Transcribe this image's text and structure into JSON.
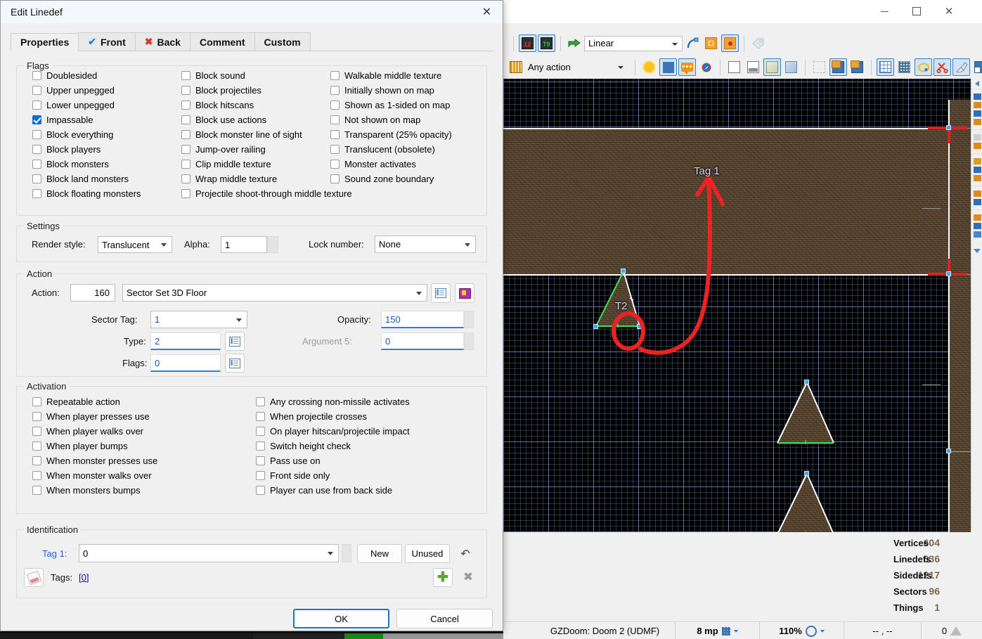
{
  "dialog": {
    "title": "Edit Linedef",
    "close_icon": "close-icon",
    "tabs": [
      {
        "label": "Properties",
        "icon": "",
        "active": true
      },
      {
        "label": "Front",
        "icon": "check-blue-icon",
        "active": false
      },
      {
        "label": "Back",
        "icon": "x-red-icon",
        "active": false
      },
      {
        "label": "Comment",
        "icon": "",
        "active": false
      },
      {
        "label": "Custom",
        "icon": "",
        "active": false
      }
    ],
    "flags": {
      "title": "Flags",
      "col1": [
        {
          "label": "Doublesided",
          "checked": false
        },
        {
          "label": "Upper unpegged",
          "checked": false
        },
        {
          "label": "Lower unpegged",
          "checked": false
        },
        {
          "label": "Impassable",
          "checked": true
        },
        {
          "label": "Block everything",
          "checked": false
        },
        {
          "label": "Block players",
          "checked": false
        },
        {
          "label": "Block monsters",
          "checked": false
        },
        {
          "label": "Block land monsters",
          "checked": false
        },
        {
          "label": "Block floating monsters",
          "checked": false
        }
      ],
      "col2": [
        {
          "label": "Block sound",
          "checked": false
        },
        {
          "label": "Block projectiles",
          "checked": false
        },
        {
          "label": "Block hitscans",
          "checked": false
        },
        {
          "label": "Block use actions",
          "checked": false
        },
        {
          "label": "Block monster line of sight",
          "checked": false
        },
        {
          "label": "Jump-over railing",
          "checked": false
        },
        {
          "label": "Clip middle texture",
          "checked": false
        },
        {
          "label": "Wrap middle texture",
          "checked": false
        },
        {
          "label": "Projectile shoot-through middle texture",
          "checked": false
        }
      ],
      "col3": [
        {
          "label": "Walkable middle texture",
          "checked": false
        },
        {
          "label": "Initially shown on map",
          "checked": false
        },
        {
          "label": "Shown as 1-sided on map",
          "checked": false
        },
        {
          "label": "Not shown on map",
          "checked": false
        },
        {
          "label": "Transparent (25% opacity)",
          "checked": false
        },
        {
          "label": "Translucent (obsolete)",
          "checked": false
        },
        {
          "label": "Monster activates",
          "checked": false
        },
        {
          "label": "Sound zone boundary",
          "checked": false
        }
      ]
    },
    "settings": {
      "title": "Settings",
      "render_style_label": "Render style:",
      "render_style_value": "Translucent",
      "alpha_label": "Alpha:",
      "alpha_value": "1",
      "lock_number_label": "Lock number:",
      "lock_number_value": "None"
    },
    "action": {
      "title": "Action",
      "action_label": "Action:",
      "action_number": "160",
      "action_name": "Sector Set 3D Floor",
      "browse_icon": "list-icon",
      "help_icon": "book-icon",
      "sector_tag_label": "Sector Tag:",
      "sector_tag_value": "1",
      "type_label": "Type:",
      "type_value": "2",
      "flags_label": "Flags:",
      "flags_value": "0",
      "opacity_label": "Opacity:",
      "opacity_value": "150",
      "argument5_label": "Argument 5:",
      "argument5_value": "0",
      "argument5_disabled": true
    },
    "activation": {
      "title": "Activation",
      "col1": [
        {
          "label": "Repeatable action",
          "checked": false
        },
        {
          "label": "When player presses use",
          "checked": false
        },
        {
          "label": "When player walks over",
          "checked": false
        },
        {
          "label": "When player bumps",
          "checked": false
        },
        {
          "label": "When monster presses use",
          "checked": false
        },
        {
          "label": "When monster walks over",
          "checked": false
        },
        {
          "label": "When monsters bumps",
          "checked": false
        }
      ],
      "col2": [
        {
          "label": "Any crossing non-missile activates",
          "checked": false
        },
        {
          "label": "When projectile crosses",
          "checked": false
        },
        {
          "label": "On player hitscan/projectile impact",
          "checked": false
        },
        {
          "label": "Switch height check",
          "checked": false
        },
        {
          "label": "Pass use on",
          "checked": false
        },
        {
          "label": "Front side only",
          "checked": false
        },
        {
          "label": "Player can use from back side",
          "checked": false
        }
      ]
    },
    "identification": {
      "title": "Identification",
      "tag1_label": "Tag 1:",
      "tag1_value": "0",
      "new_label": "New",
      "unused_label": "Unused",
      "undo_icon": "undo-icon",
      "eraser_icon": "eraser-icon",
      "tags_label": "Tags:",
      "tags_value": "[0]",
      "add_icon": "plus-icon",
      "remove_icon": "delete-icon"
    },
    "footer": {
      "ok_label": "OK",
      "cancel_label": "Cancel"
    }
  },
  "editor": {
    "window_controls": {
      "minimize": "minimize-icon",
      "maximize": "maximize-icon",
      "close": "close-icon"
    },
    "toolbar_row1": {
      "btn_12": {
        "name": "texture-12-toggle",
        "label": "12",
        "checked": true
      },
      "btn_t9": {
        "name": "texture-t9-toggle",
        "label": "T9",
        "checked": true
      },
      "export_icon": "export-icon",
      "curve_mode_value": "Linear",
      "curve_icon": "curve-icon",
      "grid_move_icon": "grid-move-icon",
      "pivot_icon": "pivot-icon",
      "tag_icon": "tag-icon"
    },
    "toolbar_row2": {
      "action_filter_icon": "columns-icon",
      "action_filter_value": "Any action",
      "brightness_icon": "brightness-icon",
      "grid_icon": "grid-icon",
      "comments_icon": "comments-icon",
      "compass_icon": "compass-icon",
      "full_bright_icon": "full-bright-icon",
      "floor_icon": "floor-icon",
      "ceiling_icon": "ceiling-icon",
      "lower_icon": "lower-icon",
      "select_icon": "marquee-select-icon",
      "sector_add_icon": "sector-add-icon",
      "sector_copy_icon": "sector-copy-icon",
      "snap_grid_icon": "snap-grid-icon",
      "grid_dense_icon": "grid-dense-icon",
      "color_picker_icon": "color-picker-icon",
      "cut_icon": "scissors-icon",
      "brush_icon": "brush-icon",
      "lock_floor_icon": "lock-floor-icon",
      "lock_ceiling_icon": "lock-ceiling-icon"
    },
    "map": {
      "annotations": [
        {
          "text": "Tag 1",
          "name": "map-annotation-tag1"
        },
        {
          "text": "T2",
          "name": "map-annotation-t2"
        }
      ]
    },
    "stats": [
      {
        "value": "604",
        "label": "Vertices"
      },
      {
        "value": "636",
        "label": "Linedefs"
      },
      {
        "value": "1217",
        "label": "Sidedefs"
      },
      {
        "value": "96",
        "label": "Sectors"
      },
      {
        "value": "1",
        "label": "Things"
      }
    ],
    "statusbar": {
      "game_config": "GZDoom: Doom 2 (UDMF)",
      "grid_size": "8 mp",
      "zoom": "110%",
      "coordinates": "-- , --",
      "counter": "0",
      "grid_icon": "grid-icon",
      "zoom_icon": "magnifier-icon",
      "triangle_icon": "triangle-icon"
    }
  },
  "colors": {
    "accent": "#1877c9",
    "annotation_red": "#ee2222",
    "map_background": "#000000",
    "texture_brown": "#5b4630",
    "stats_text": "#7a6a55"
  }
}
